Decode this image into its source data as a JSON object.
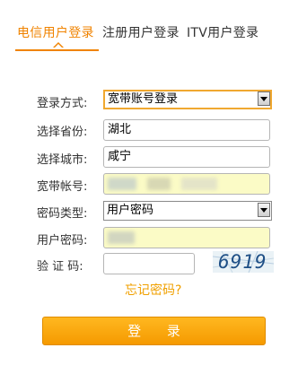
{
  "tabs": [
    {
      "label": "电信用户登录",
      "active": true
    },
    {
      "label": "注册用户登录",
      "active": false
    },
    {
      "label": "ITV用户登录",
      "active": false
    }
  ],
  "form": {
    "login_method": {
      "label": "登录方式:",
      "value": "宽带账号登录"
    },
    "province": {
      "label": "选择省份:",
      "value": "湖北"
    },
    "city": {
      "label": "选择城市:",
      "value": "咸宁"
    },
    "account": {
      "label": "宽带帐号:",
      "value": ""
    },
    "password_type": {
      "label": "密码类型:",
      "value": "用户密码"
    },
    "password": {
      "label": "用户密码:",
      "value": ""
    },
    "captcha": {
      "label": "验 证 码:",
      "value": "",
      "image_text": "6919"
    }
  },
  "forgot_password": "忘记密码?",
  "login_button": "登 录",
  "colors": {
    "accent": "#f08300",
    "input_fill": "#fbfbc6",
    "button": "#f5a000"
  }
}
